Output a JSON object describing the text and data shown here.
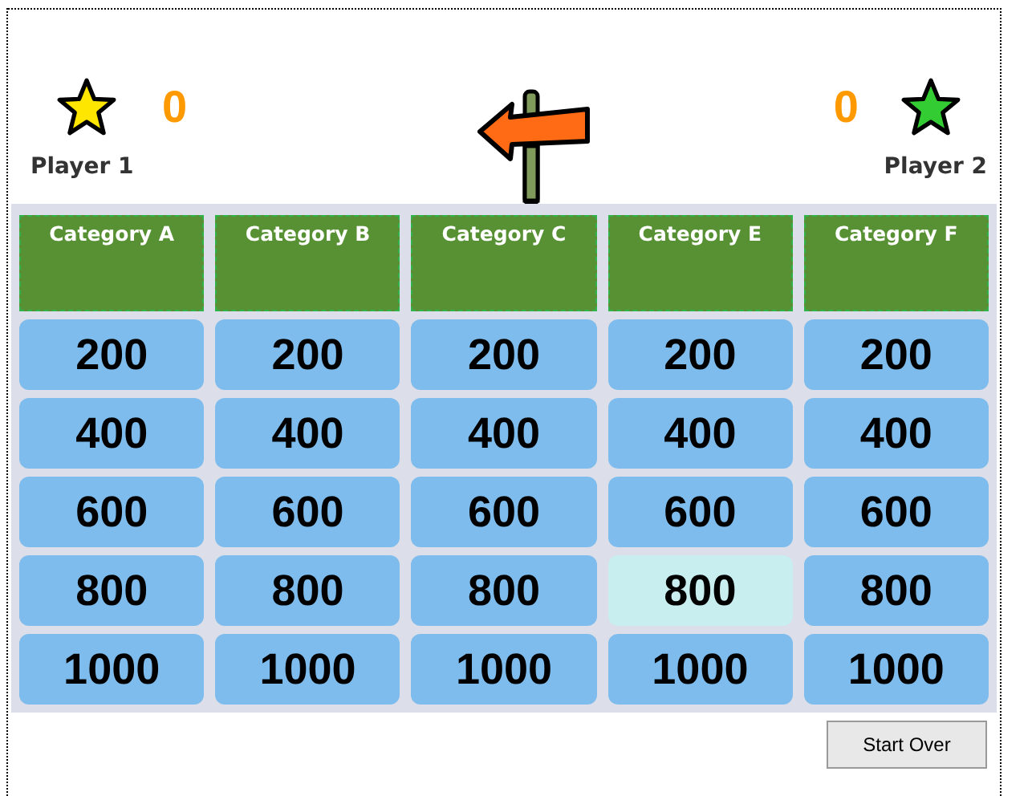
{
  "players": [
    {
      "name": "Player 1",
      "score": "0",
      "color": "#ffe600"
    },
    {
      "name": "Player 2",
      "score": "0",
      "color": "#33cc33"
    }
  ],
  "board": {
    "categories": [
      {
        "title": "Category A",
        "tiles": [
          {
            "value": "200",
            "highlighted": false
          },
          {
            "value": "400",
            "highlighted": false
          },
          {
            "value": "600",
            "highlighted": false
          },
          {
            "value": "800",
            "highlighted": false
          },
          {
            "value": "1000",
            "highlighted": false
          }
        ]
      },
      {
        "title": "Category B",
        "tiles": [
          {
            "value": "200",
            "highlighted": false
          },
          {
            "value": "400",
            "highlighted": false
          },
          {
            "value": "600",
            "highlighted": false
          },
          {
            "value": "800",
            "highlighted": false
          },
          {
            "value": "1000",
            "highlighted": false
          }
        ]
      },
      {
        "title": "Category C",
        "tiles": [
          {
            "value": "200",
            "highlighted": false
          },
          {
            "value": "400",
            "highlighted": false
          },
          {
            "value": "600",
            "highlighted": false
          },
          {
            "value": "800",
            "highlighted": false
          },
          {
            "value": "1000",
            "highlighted": false
          }
        ]
      },
      {
        "title": "Category E",
        "tiles": [
          {
            "value": "200",
            "highlighted": false
          },
          {
            "value": "400",
            "highlighted": false
          },
          {
            "value": "600",
            "highlighted": false
          },
          {
            "value": "800",
            "highlighted": true
          },
          {
            "value": "1000",
            "highlighted": false
          }
        ]
      },
      {
        "title": "Category F",
        "tiles": [
          {
            "value": "200",
            "highlighted": false
          },
          {
            "value": "400",
            "highlighted": false
          },
          {
            "value": "600",
            "highlighted": false
          },
          {
            "value": "800",
            "highlighted": false
          },
          {
            "value": "1000",
            "highlighted": false
          }
        ]
      }
    ]
  },
  "start_over_button": "Start Over"
}
